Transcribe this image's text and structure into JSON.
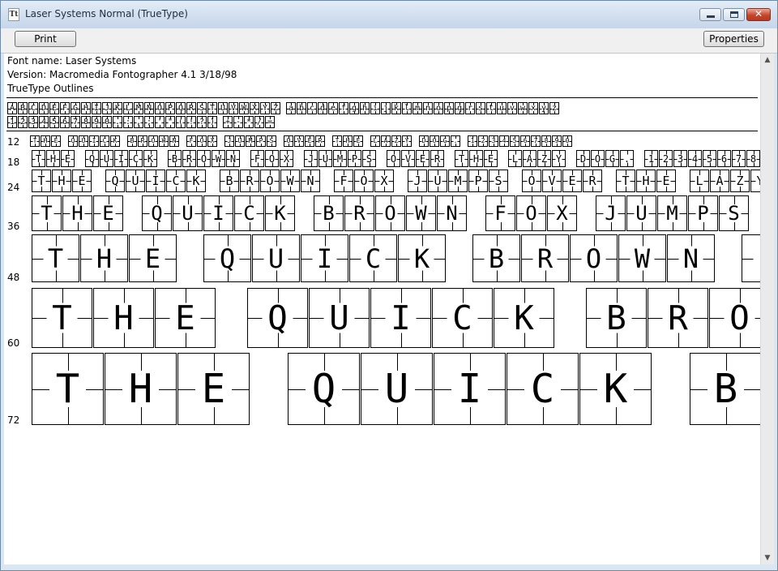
{
  "window": {
    "title": "Laser Systems Normal (TrueType)",
    "app_icon": "font-file-icon",
    "icon_glyph": "Tt"
  },
  "toolbar": {
    "print_label": "Print",
    "properties_label": "Properties"
  },
  "font_info": {
    "name_line": "Font name: Laser Systems",
    "version_line": "Version: Macromedia Fontographer 4.1 3/18/98",
    "outline_line": "TrueType Outlines"
  },
  "charset": {
    "line1": "ABCDEFGHIJKLMNOPQRSTUVWXYZ abcdefghijklmnopqrstuvwxyz",
    "line2": "1234567890.:,;'\"(!?) +-*/="
  },
  "samples": {
    "text": "THE QUICK BROWN FOX JUMPS OVER THE LAZY DOG. 1234567890",
    "sizes": [
      "12",
      "18",
      "24",
      "36",
      "48",
      "60",
      "72"
    ]
  },
  "colors": {
    "titlebar": "#d3e0ef",
    "close_button": "#c8452c",
    "background": "#ffffff"
  }
}
